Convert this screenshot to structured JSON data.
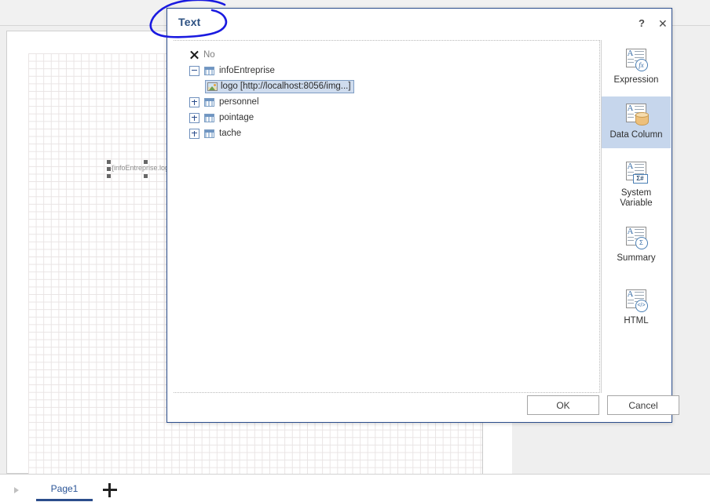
{
  "designer": {
    "canvas_field_label": "{infoEntreprise.logo}",
    "page_tab_label": "Page1",
    "add_page_label": "+",
    "prev_pages_arrow": "▶"
  },
  "dialog": {
    "title": "Text",
    "help_button": "?",
    "close_button": "✕",
    "tree": [
      {
        "label": "No",
        "icon": "x-icon",
        "kind": "none-row",
        "expander": null
      },
      {
        "label": "infoEntreprise",
        "icon": "table-icon",
        "kind": "table",
        "expander": "minus"
      },
      {
        "label": "logo [http://localhost:8056/img...]",
        "icon": "image-column-icon",
        "kind": "column",
        "expander": null,
        "selected": true
      },
      {
        "label": "personnel",
        "icon": "table-icon",
        "kind": "table",
        "expander": "plus"
      },
      {
        "label": "pointage",
        "icon": "table-icon",
        "kind": "table",
        "expander": "plus"
      },
      {
        "label": "tache",
        "icon": "table-icon",
        "kind": "table",
        "expander": "plus"
      }
    ],
    "rail": [
      {
        "label": "Expression",
        "icon": "expression-icon",
        "badge": "fx",
        "active": false
      },
      {
        "label": "Data Column",
        "icon": "data-column-icon",
        "badge": "database",
        "active": true
      },
      {
        "label": "System\nVariable",
        "label_line1": "System",
        "label_line2": "Variable",
        "icon": "system-variable-icon",
        "badge": "Σ#",
        "active": false
      },
      {
        "label": "Summary",
        "icon": "summary-icon",
        "badge": "Σ",
        "active": false
      },
      {
        "label": "HTML",
        "icon": "html-icon",
        "badge": "</>",
        "active": false
      }
    ],
    "buttons": {
      "ok": "OK",
      "cancel": "Cancel"
    }
  },
  "colors": {
    "dialog_border": "#2b4d8c",
    "title_text": "#2d5182",
    "selection_bg": "#cfdcee",
    "rail_active_bg": "#c6d6ec",
    "annotation": "#1a1ae0",
    "page_tab_underline": "#2b4d8c"
  }
}
